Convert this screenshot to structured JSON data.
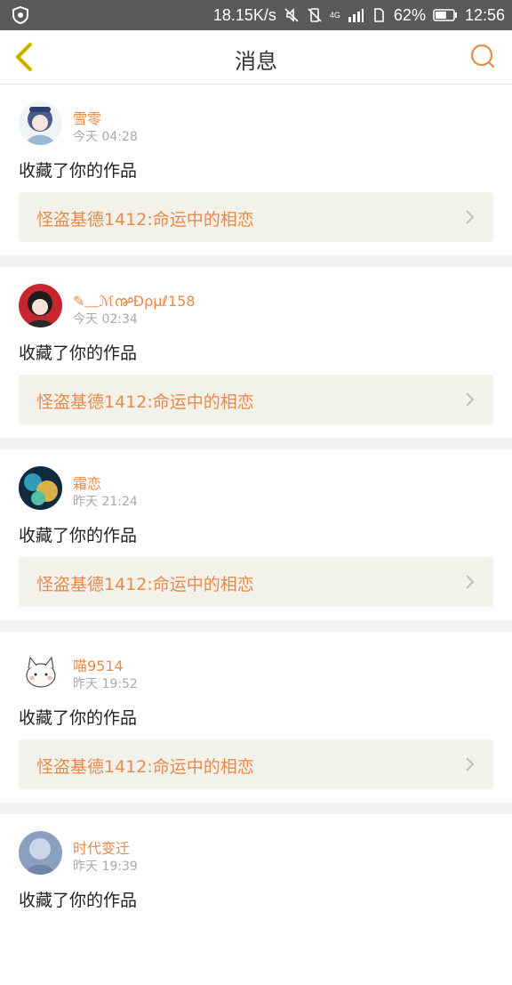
{
  "statusbar": {
    "speed": "18.15K/s",
    "network": "4G",
    "battery_percent": "62%",
    "battery_level": 0.62,
    "time": "12:56",
    "icons": [
      "shield-icon",
      "mute-icon",
      "vibrate-icon",
      "signal-icon",
      "sim-icon",
      "battery-icon"
    ]
  },
  "navbar": {
    "title": "消息",
    "back_icon": "chevron-left-icon",
    "search_icon": "search-icon",
    "accent": "#e98a4a",
    "back_color": "#e0c000"
  },
  "messages": [
    {
      "user": "雪零",
      "time": "今天 04:28",
      "action": "收藏了你的作品",
      "work": "怪盗基德1412:命运中的相恋"
    },
    {
      "user": "✎﹏ℳ൲Ðρμℓ158",
      "time": "今天 02:34",
      "action": "收藏了你的作品",
      "work": "怪盗基德1412:命运中的相恋"
    },
    {
      "user": "霜恋",
      "time": "昨天 21:24",
      "action": "收藏了你的作品",
      "work": "怪盗基德1412:命运中的相恋"
    },
    {
      "user": "喵9514",
      "time": "昨天 19:52",
      "action": "收藏了你的作品",
      "work": "怪盗基德1412:命运中的相恋"
    },
    {
      "user": "时代变迁",
      "time": "昨天 19:39",
      "action": "收藏了你的作品",
      "work": ""
    }
  ]
}
